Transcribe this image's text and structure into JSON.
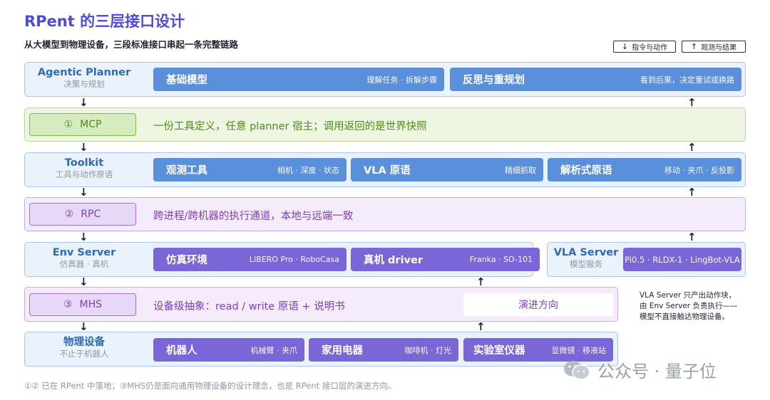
{
  "title": "RPent 的三层接口设计",
  "subtitle": "从大模型到物理设备，三段标准接口串起一条完整链路",
  "legend": [
    {
      "arrow": "↓",
      "label": "指令与动作"
    },
    {
      "arrow": "↑",
      "label": "观测与结果"
    }
  ],
  "layers": {
    "planner": {
      "name": "Agentic Planner",
      "sub": "决策与规划",
      "chips": [
        {
          "name": "基础模型",
          "desc": "理解任务 · 拆解步骤"
        },
        {
          "name": "反思与重规划",
          "desc": "看到后果，决定重试或换路"
        }
      ]
    },
    "mcp": {
      "num": "①",
      "name": "MCP",
      "desc": "一份工具定义，任意 planner 宿主；调用返回的是世界快照"
    },
    "toolkit": {
      "name": "Toolkit",
      "sub": "工具与动作原语",
      "chips": [
        {
          "name": "观测工具",
          "desc": "相机 · 深度 · 状态"
        },
        {
          "name": "VLA 原语",
          "desc": "精细抓取"
        },
        {
          "name": "解析式原语",
          "desc": "移动 · 夹爪 · 反投影"
        }
      ]
    },
    "rpc": {
      "num": "②",
      "name": "RPC",
      "desc": "跨进程/跨机器的执行通道，本地与远端一致"
    },
    "env": {
      "name": "Env Server",
      "sub": "仿真器 · 真机",
      "chips": [
        {
          "name": "仿真环境",
          "desc": "LIBERO Pro · RoboCasa"
        },
        {
          "name": "真机 driver",
          "desc": "Franka · SO-101"
        }
      ]
    },
    "vla": {
      "name": "VLA Server",
      "sub": "模型服务",
      "chip": "Pi0.5 · RLDX-1 · LingBot-VLA"
    },
    "mhs": {
      "num": "③",
      "name": "MHS",
      "desc": "设备级抽象：read / write 原语 + 说明书",
      "evo": "演进方向"
    },
    "device": {
      "name": "物理设备",
      "sub": "不止于机器人",
      "chips": [
        {
          "name": "机器人",
          "desc": "机械臂 · 夹爪"
        },
        {
          "name": "家用电器",
          "desc": "咖啡机 · 灯光"
        },
        {
          "name": "实验室仪器",
          "desc": "显微镜 · 移液站"
        }
      ]
    }
  },
  "arrows": {
    "down": "↓",
    "up": "↑"
  },
  "note": [
    "VLA Server 只产出动作块，",
    "由 Env Server 负责执行——",
    "模型不直接触达物理设备。"
  ],
  "footer": "①② 已在 RPent 中落地；③MHS仍是面向通用物理设备的设计理念，也是 RPent 接口层的演进方向。",
  "watermark": {
    "label": "公众号 · 量子位",
    "icon": "wechat-icon"
  },
  "colors": {
    "accent": "#4f4cd9",
    "blue": "#5a8fdc",
    "purple": "#7a66d6",
    "green": "#7dbb4b"
  }
}
